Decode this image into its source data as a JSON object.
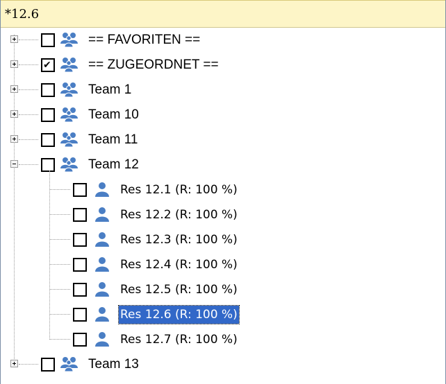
{
  "filter": {
    "value": "*12.6"
  },
  "tree": {
    "groups": [
      {
        "label": "== FAVORITEN ==",
        "checked": false,
        "expanded": false
      },
      {
        "label": "== ZUGEORDNET ==",
        "checked": true,
        "expanded": false
      },
      {
        "label": "Team 1",
        "checked": false,
        "expanded": false
      },
      {
        "label": "Team 10",
        "checked": false,
        "expanded": false
      },
      {
        "label": "Team 11",
        "checked": false,
        "expanded": false
      },
      {
        "label": "Team 12",
        "checked": false,
        "expanded": true,
        "children": [
          {
            "label": "Res 12.1 (R: 100 %)",
            "checked": false,
            "selected": false
          },
          {
            "label": "Res 12.2 (R: 100 %)",
            "checked": false,
            "selected": false
          },
          {
            "label": "Res 12.3 (R: 100 %)",
            "checked": false,
            "selected": false
          },
          {
            "label": "Res 12.4 (R: 100 %)",
            "checked": false,
            "selected": false
          },
          {
            "label": "Res 12.5 (R: 100 %)",
            "checked": false,
            "selected": false
          },
          {
            "label": "Res 12.6 (R: 100 %)",
            "checked": false,
            "selected": true
          },
          {
            "label": "Res 12.7 (R: 100 %)",
            "checked": false,
            "selected": false
          }
        ]
      },
      {
        "label": "Team 13",
        "checked": false,
        "expanded": false
      }
    ],
    "check_glyph": "✔",
    "group_icon": "group-people-icon",
    "resource_icon": "person-icon",
    "colors": {
      "icon_blue": "#4a7ec4",
      "selection": "#3268c8",
      "filter_background": "#fdf5c7"
    }
  }
}
